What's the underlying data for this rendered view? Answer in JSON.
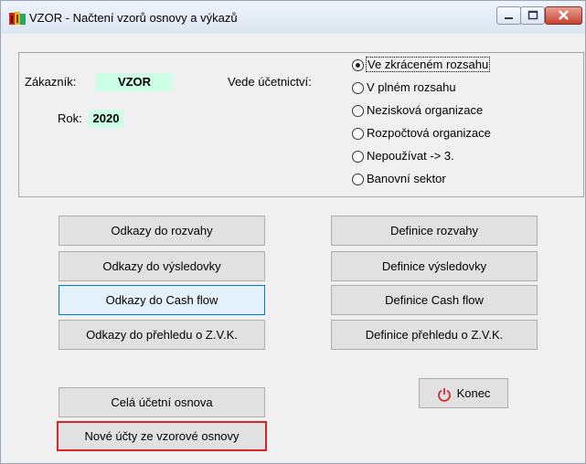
{
  "window": {
    "title": "VZOR - Načtení vzorů osnovy a výkazů",
    "controls": [
      "minimize-icon",
      "maximize-icon",
      "close-icon"
    ]
  },
  "customer": {
    "label": "Zákazník:",
    "value": "VZOR"
  },
  "year": {
    "label": "Rok:",
    "value": "2020"
  },
  "accounting": {
    "label": "Vede účetnictví:",
    "options": [
      {
        "label": "Ve zkráceném rozsahu",
        "selected": true
      },
      {
        "label": "V plném rozsahu",
        "selected": false
      },
      {
        "label": "Nezisková organizace",
        "selected": false
      },
      {
        "label": "Rozpočtová organizace",
        "selected": false
      },
      {
        "label": "Nepoužívat -> 3.",
        "selected": false
      },
      {
        "label": "Banovní sektor",
        "selected": false
      }
    ]
  },
  "buttons": {
    "left": [
      "Odkazy do rozvahy",
      "Odkazy do výsledovky",
      "Odkazy do Cash flow",
      "Odkazy do přehledu o Z.V.K."
    ],
    "right": [
      "Definice rozvahy",
      "Definice výsledovky",
      "Definice Cash flow",
      "Definice přehledu o Z.V.K."
    ],
    "whole_chart": "Celá účetní osnova",
    "new_accounts": "Nové účty ze vzorové osnovy",
    "exit": "Konec"
  },
  "colors": {
    "value_background": "#ccffe5",
    "highlight_border": "#d9242a",
    "exit_icon": "#d9242a",
    "hover_border": "#0078d7"
  }
}
